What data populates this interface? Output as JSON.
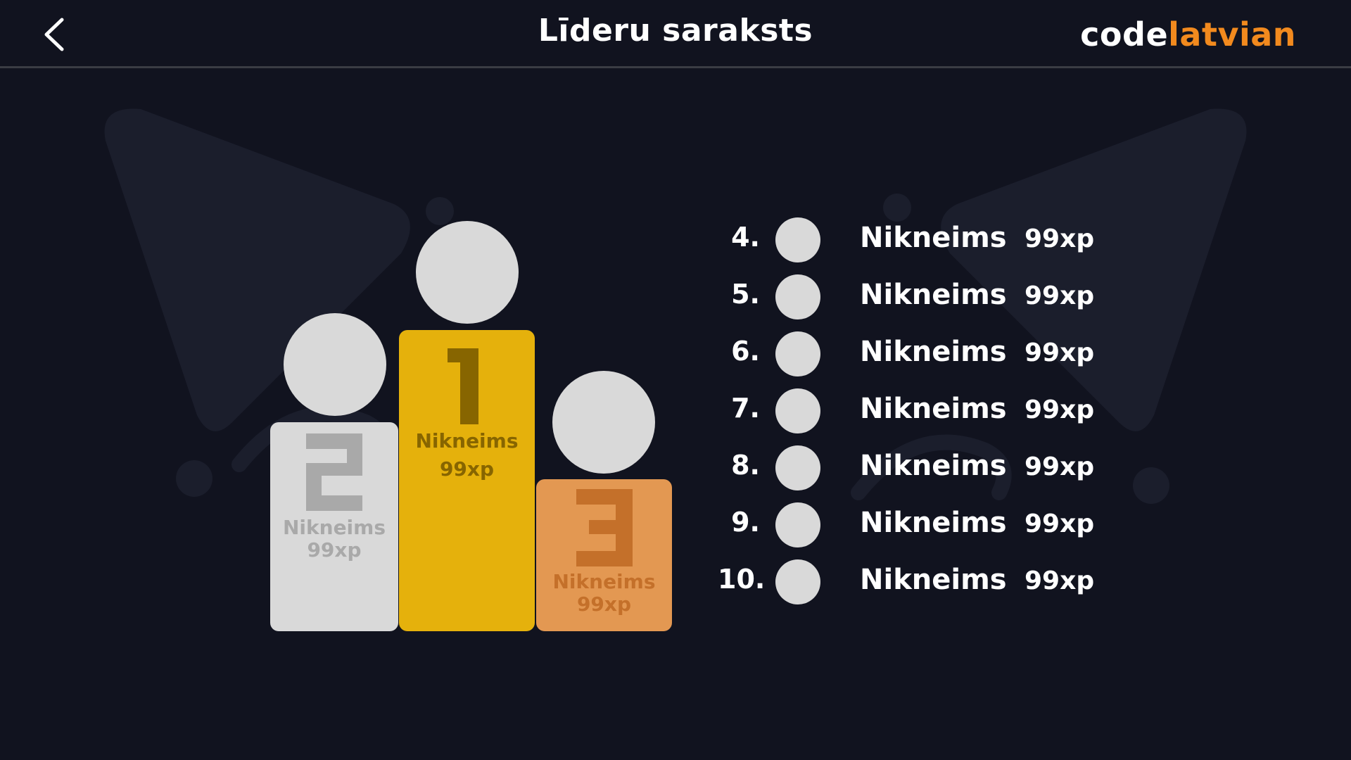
{
  "header": {
    "title": "Līderu saraksts",
    "back_icon": "chevron-left-icon",
    "logo": {
      "part1": "code",
      "part2": "latvian"
    }
  },
  "colors": {
    "background": "#11131f",
    "accent": "#f28a1e",
    "gold": "#e5b10c",
    "silver": "#d9d9d9",
    "bronze": "#e39852"
  },
  "podium": {
    "first": {
      "rank": "1",
      "name": "Nikneims",
      "xp": "99xp"
    },
    "second": {
      "rank": "2",
      "name": "Nikneims",
      "xp": "99xp"
    },
    "third": {
      "rank": "3",
      "name": "Nikneims",
      "xp": "99xp"
    }
  },
  "leaderboard": [
    {
      "rank": "4.",
      "name": "Nikneims",
      "xp": "99xp"
    },
    {
      "rank": "5.",
      "name": "Nikneims",
      "xp": "99xp"
    },
    {
      "rank": "6.",
      "name": "Nikneims",
      "xp": "99xp"
    },
    {
      "rank": "7.",
      "name": "Nikneims",
      "xp": "99xp"
    },
    {
      "rank": "8.",
      "name": "Nikneims",
      "xp": "99xp"
    },
    {
      "rank": "9.",
      "name": "Nikneims",
      "xp": "99xp"
    },
    {
      "rank": "10.",
      "name": "Nikneims",
      "xp": "99xp"
    }
  ]
}
